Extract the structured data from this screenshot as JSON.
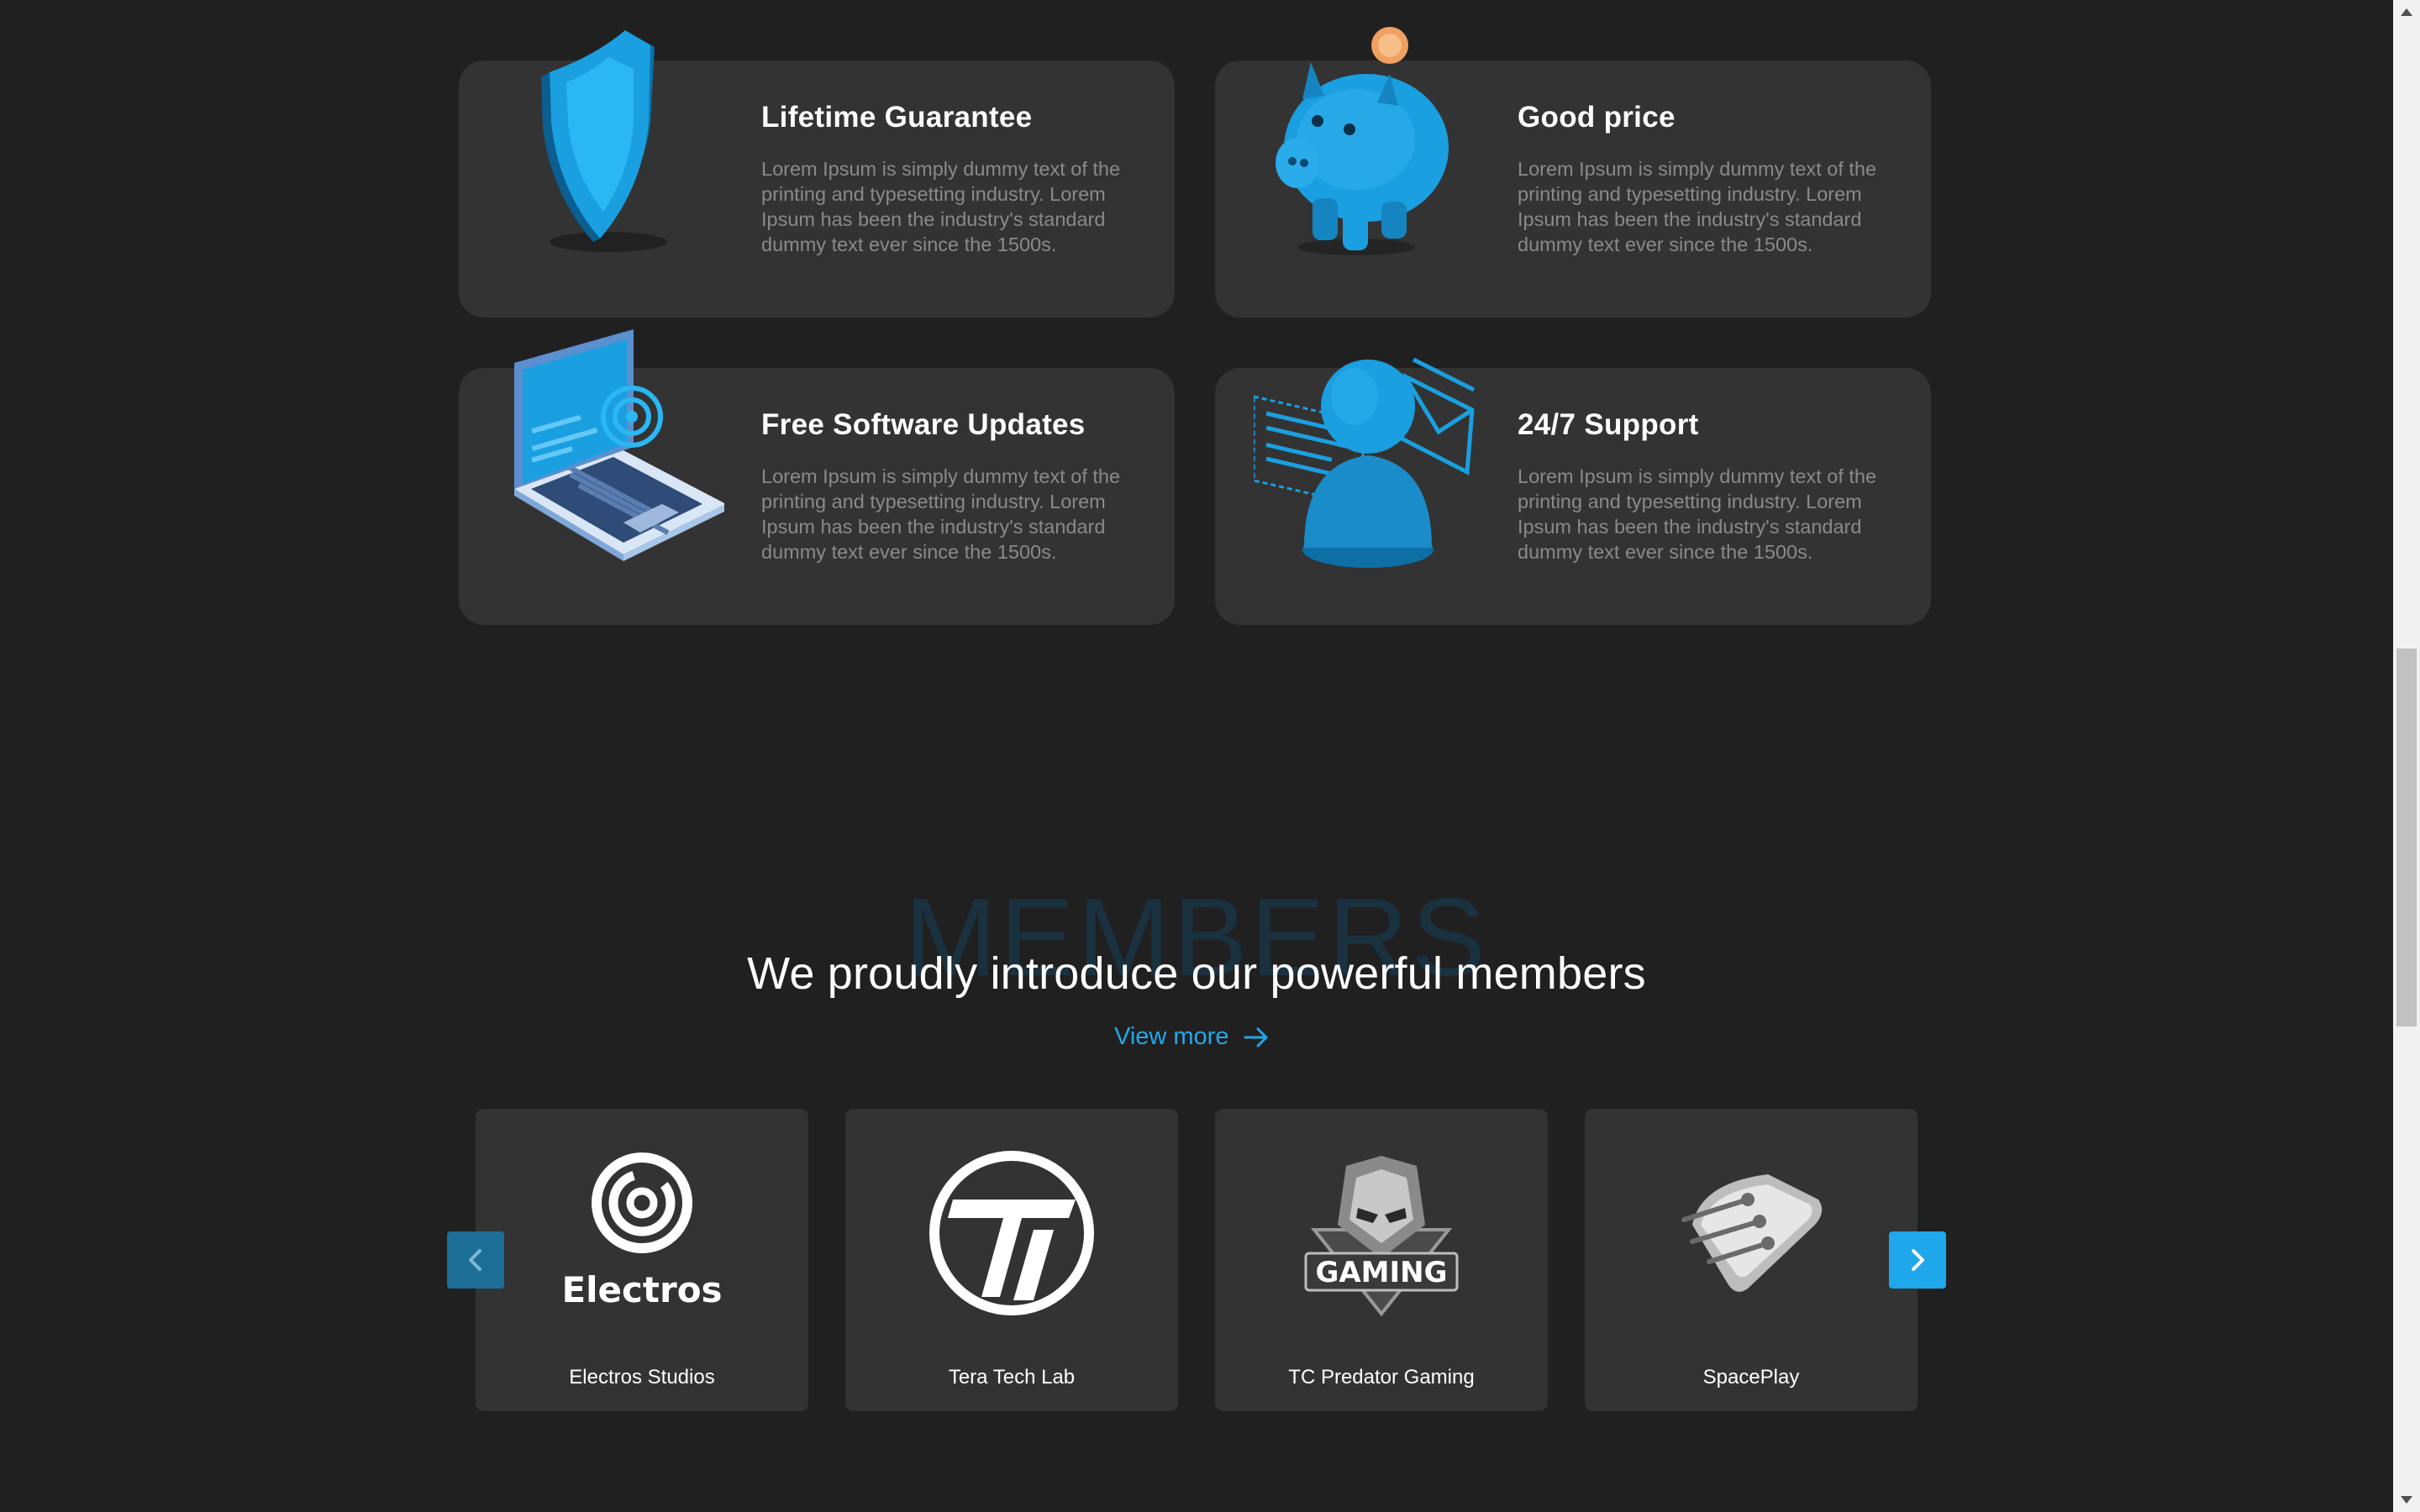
{
  "features": [
    {
      "title": "Lifetime Guarantee",
      "description": "Lorem Ipsum is simply dummy text of the printing and typesetting industry. Lorem Ipsum has been the industry's standard dummy text ever since the 1500s.",
      "icon": "shield-icon"
    },
    {
      "title": "Good price",
      "description": "Lorem Ipsum is simply dummy text of the printing and typesetting industry. Lorem Ipsum has been the industry's standard dummy text ever since the 1500s.",
      "icon": "piggy-bank-icon"
    },
    {
      "title": "Free Software Updates",
      "description": "Lorem Ipsum is simply dummy text of the printing and typesetting industry. Lorem Ipsum has been the industry's standard dummy text ever since the 1500s.",
      "icon": "laptop-icon"
    },
    {
      "title": "24/7 Support",
      "description": "Lorem Ipsum is simply dummy text of the printing and typesetting industry. Lorem Ipsum has been the industry's standard dummy text ever since the 1500s.",
      "icon": "support-agent-icon"
    }
  ],
  "members": {
    "watermark": "MEMBERS",
    "heading": "We proudly introduce our powerful members",
    "view_more": "View more",
    "items": [
      {
        "name": "Electros Studios",
        "logo_text": "Electros"
      },
      {
        "name": "Tera Tech Lab"
      },
      {
        "name": "TC Predator Gaming",
        "logo_text": "GAMING"
      },
      {
        "name": "SpacePlay"
      }
    ]
  },
  "colors": {
    "background": "#202020",
    "card": "#333333",
    "accent": "#1ea7ea",
    "muted_text": "#8a8a8a"
  }
}
